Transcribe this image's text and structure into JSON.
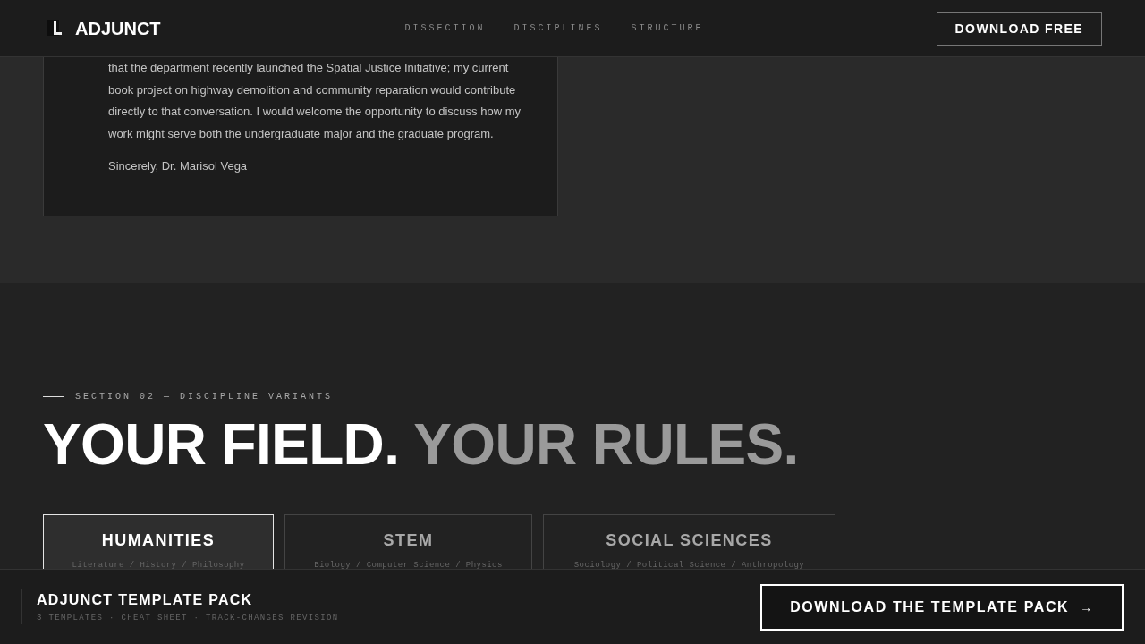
{
  "header": {
    "brand": "ADJUNCT",
    "nav": [
      "DISSECTION",
      "DISCIPLINES",
      "STRUCTURE"
    ],
    "cta": "DOWNLOAD FREE"
  },
  "letter": {
    "paragraph": "that the department recently launched the Spatial Justice Initiative; my current book project on highway demolition and community reparation would contribute directly to that conversation. I would welcome the opportunity to discuss how my work might serve both the undergraduate major and the graduate program.",
    "signoff": "Sincerely, Dr. Marisol Vega"
  },
  "section": {
    "eyebrow": "SECTION 02 — DISCIPLINE VARIANTS",
    "title_main": "YOUR FIELD.",
    "title_muted": "YOUR RULES."
  },
  "tabs": [
    {
      "label": "HUMANITIES",
      "subtitle": "Literature / History / Philosophy",
      "selected": true
    },
    {
      "label": "STEM",
      "subtitle": "Biology / Computer Science / Physics",
      "selected": false
    },
    {
      "label": "SOCIAL SCIENCES",
      "subtitle": "Sociology / Political Science / Anthropology",
      "selected": false
    }
  ],
  "footer": {
    "title": "ADJUNCT TEMPLATE PACK",
    "subtitle": "3 TEMPLATES · CHEAT SHEET · TRACK-CHANGES REVISION",
    "cta": "DOWNLOAD THE TEMPLATE PACK",
    "arrow": "→"
  }
}
